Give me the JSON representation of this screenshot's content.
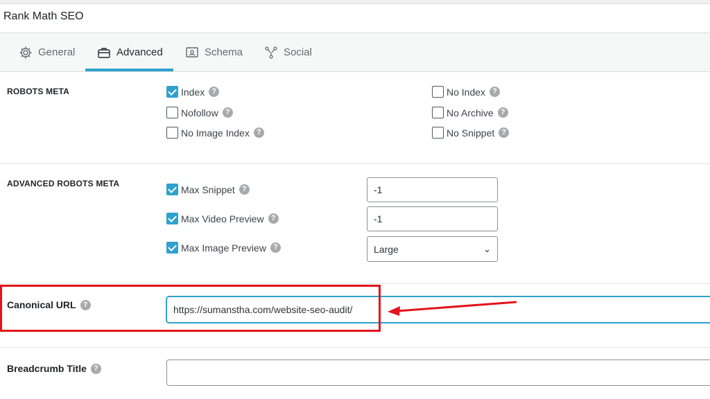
{
  "panel": {
    "title": "Rank Math SEO"
  },
  "tabs": [
    {
      "label": "General",
      "icon": "gear-icon"
    },
    {
      "label": "Advanced",
      "icon": "briefcase-icon",
      "active": true
    },
    {
      "label": "Schema",
      "icon": "schema-icon"
    },
    {
      "label": "Social",
      "icon": "share-icon"
    }
  ],
  "robots_meta": {
    "label": "ROBOTS META",
    "options": [
      {
        "label": "Index",
        "checked": true
      },
      {
        "label": "Nofollow",
        "checked": false
      },
      {
        "label": "No Image Index",
        "checked": false
      },
      {
        "label": "No Index",
        "checked": false
      },
      {
        "label": "No Archive",
        "checked": false
      },
      {
        "label": "No Snippet",
        "checked": false
      }
    ]
  },
  "advanced_robots_meta": {
    "label": "ADVANCED ROBOTS META",
    "max_snippet": {
      "label": "Max Snippet",
      "checked": true,
      "value": "-1"
    },
    "max_video_preview": {
      "label": "Max Video Preview",
      "checked": true,
      "value": "-1"
    },
    "max_image_preview": {
      "label": "Max Image Preview",
      "checked": true,
      "value": "Large"
    }
  },
  "canonical": {
    "label": "Canonical URL",
    "value": "https://sumanstha.com/website-seo-audit/"
  },
  "breadcrumb": {
    "label": "Breadcrumb Title",
    "value": ""
  },
  "help_glyph": "?",
  "colors": {
    "accent": "#2ea2cc",
    "highlight": "#e3131c"
  }
}
